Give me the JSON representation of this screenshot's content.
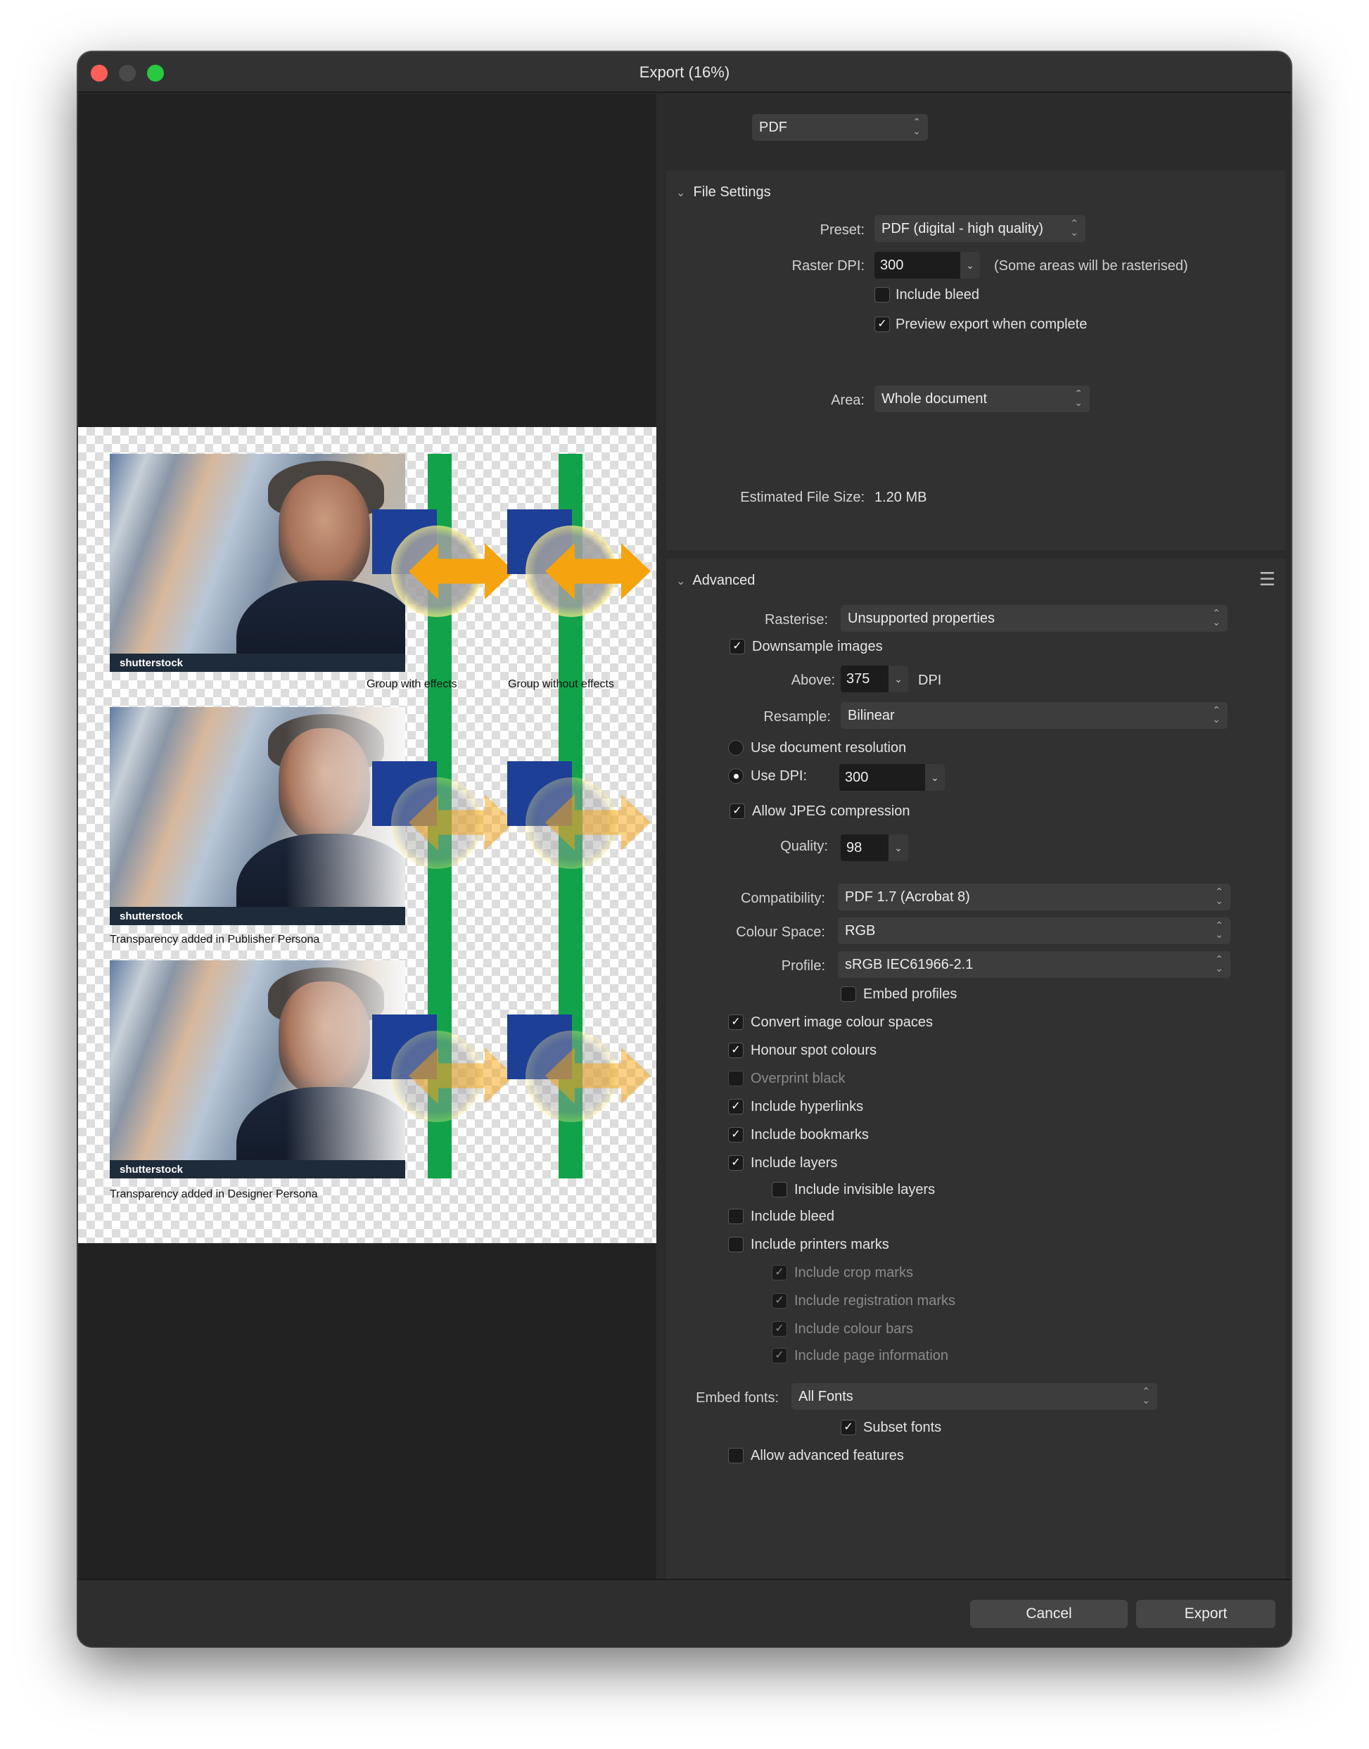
{
  "window": {
    "title": "Export (16%)"
  },
  "format": {
    "value": "PDF"
  },
  "preview": {
    "captions": {
      "group_with": "Group with effects",
      "group_without": "Group without effects",
      "publisher": "Transparency added in Publisher Persona",
      "designer": "Transparency added in Designer Persona"
    },
    "watermark": "shutterstock"
  },
  "file_settings": {
    "header": "File Settings",
    "preset_label": "Preset:",
    "preset_value": "PDF (digital - high quality)",
    "raster_dpi_label": "Raster DPI:",
    "raster_dpi_value": "300",
    "raster_note": "(Some areas will be rasterised)",
    "include_bleed": "Include bleed",
    "preview_export": "Preview export when complete",
    "area_label": "Area:",
    "area_value": "Whole document",
    "est_label": "Estimated File Size:",
    "est_value": "1.20 MB"
  },
  "advanced": {
    "header": "Advanced",
    "rasterise_label": "Rasterise:",
    "rasterise_value": "Unsupported properties",
    "downsample": "Downsample images",
    "above_label": "Above:",
    "above_value": "375",
    "dpi_unit": "DPI",
    "resample_label": "Resample:",
    "resample_value": "Bilinear",
    "use_doc_res": "Use document resolution",
    "use_dpi_label": "Use DPI:",
    "use_dpi_value": "300",
    "allow_jpeg": "Allow JPEG compression",
    "quality_label": "Quality:",
    "quality_value": "98",
    "compat_label": "Compatibility:",
    "compat_value": "PDF 1.7 (Acrobat 8)",
    "colour_space_label": "Colour Space:",
    "colour_space_value": "RGB",
    "profile_label": "Profile:",
    "profile_value": "sRGB IEC61966-2.1",
    "embed_profiles": "Embed profiles",
    "convert_colour": "Convert image colour spaces",
    "honour_spot": "Honour spot colours",
    "overprint_black": "Overprint black",
    "include_hyperlinks": "Include hyperlinks",
    "include_bookmarks": "Include bookmarks",
    "include_layers": "Include layers",
    "include_invisible": "Include invisible layers",
    "include_bleed": "Include bleed",
    "include_printers": "Include printers marks",
    "crop_marks": "Include crop marks",
    "registration_marks": "Include registration marks",
    "colour_bars": "Include colour bars",
    "page_info": "Include page information",
    "embed_fonts_label": "Embed fonts:",
    "embed_fonts_value": "All Fonts",
    "subset_fonts": "Subset fonts",
    "allow_advanced": "Allow advanced features"
  },
  "footer": {
    "cancel": "Cancel",
    "export": "Export"
  },
  "colors": {
    "close": "#ff5f57",
    "minimize": "#4a4a4a",
    "zoom": "#28c840",
    "accent_green": "#12a34a",
    "accent_orange": "#f5a30e",
    "accent_blue": "#1d3f96"
  }
}
